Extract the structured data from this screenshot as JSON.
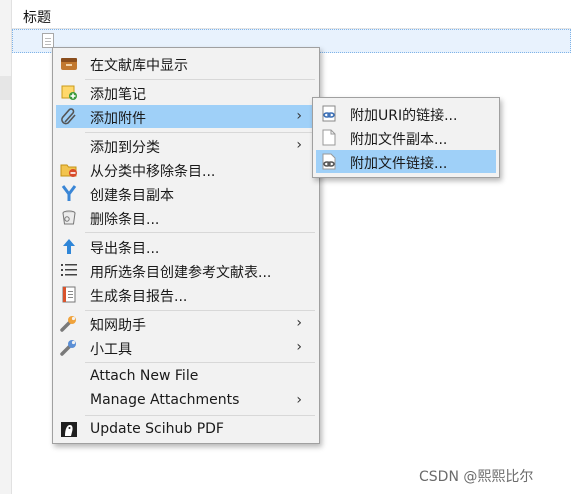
{
  "column_header": "标题",
  "context_menu": {
    "items": [
      {
        "label": "在文献库中显示",
        "icon": "library-box-icon"
      },
      {
        "label": "添加笔记",
        "icon": "note-add-icon"
      },
      {
        "label": "添加附件",
        "icon": "paperclip-icon",
        "submenu": true,
        "highlighted": true
      },
      {
        "label": "添加到分类",
        "icon": "",
        "submenu": true
      },
      {
        "label": "从分类中移除条目...",
        "icon": "folder-remove-icon"
      },
      {
        "label": "创建条目副本",
        "icon": "duplicate-icon"
      },
      {
        "label": "删除条目...",
        "icon": "trash-icon"
      },
      {
        "label": "导出条目...",
        "icon": "export-arrow-icon"
      },
      {
        "label": "用所选条目创建参考文献表...",
        "icon": "bibliography-list-icon"
      },
      {
        "label": "生成条目报告...",
        "icon": "report-icon"
      },
      {
        "label": "知网助手",
        "icon": "wrench-icon",
        "submenu": true
      },
      {
        "label": "小工具",
        "icon": "wrench-icon",
        "submenu": true
      },
      {
        "label": "Attach New File",
        "icon": ""
      },
      {
        "label": "Manage Attachments",
        "icon": "",
        "submenu": true
      },
      {
        "label": "Update Scihub PDF",
        "icon": "scihub-icon"
      }
    ],
    "submenu_arrow": "›"
  },
  "attachment_submenu": {
    "items": [
      {
        "label": "附加URI的链接...",
        "icon": "link-document-icon"
      },
      {
        "label": "附加文件副本...",
        "icon": "blank-file-icon"
      },
      {
        "label": "附加文件链接...",
        "icon": "link-file-icon",
        "highlighted": true
      }
    ]
  },
  "watermark": "CSDN @熙熙比尔",
  "colors": {
    "highlight": "#9fd0f8",
    "menu_bg": "#f2f2f2",
    "selection_row": "#e8f2fd"
  }
}
